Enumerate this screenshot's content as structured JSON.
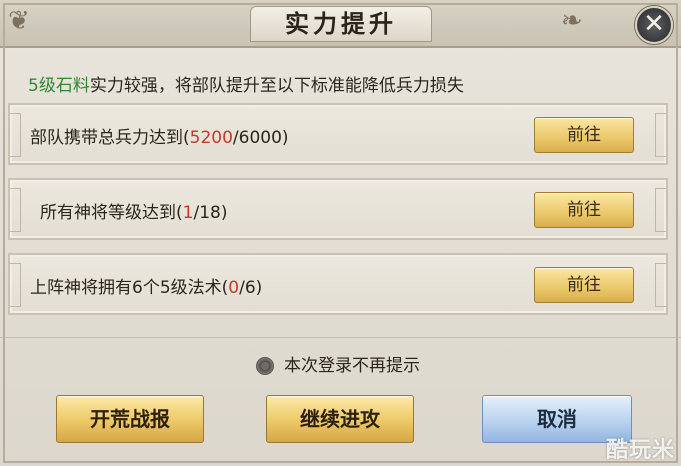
{
  "dialog": {
    "title": "实力提升",
    "close_icon": "close-icon"
  },
  "intro": {
    "highlight": "5级石料",
    "text": "实力较强，将部队提升至以下标准能降低兵力损失"
  },
  "tasks": [
    {
      "prefix": "部队携带总兵力达到(",
      "current": "5200",
      "suffix": "/6000)",
      "button": "前往"
    },
    {
      "prefix": "所有神将等级达到(",
      "current": "1",
      "suffix": "/18)",
      "button": "前往"
    },
    {
      "prefix": "上阵神将拥有6个5级法术(",
      "current": "0",
      "suffix": "/6)",
      "button": "前往"
    }
  ],
  "checkbox": {
    "label": "本次登录不再提示"
  },
  "footer": {
    "report": "开荒战报",
    "continue": "继续进攻",
    "cancel": "取消"
  },
  "watermark": "酷玩米",
  "colors": {
    "highlight_green": "#2f8a2f",
    "progress_red": "#c23b2b",
    "gold_button": "#eac86a",
    "blue_button": "#b9d2ee"
  }
}
